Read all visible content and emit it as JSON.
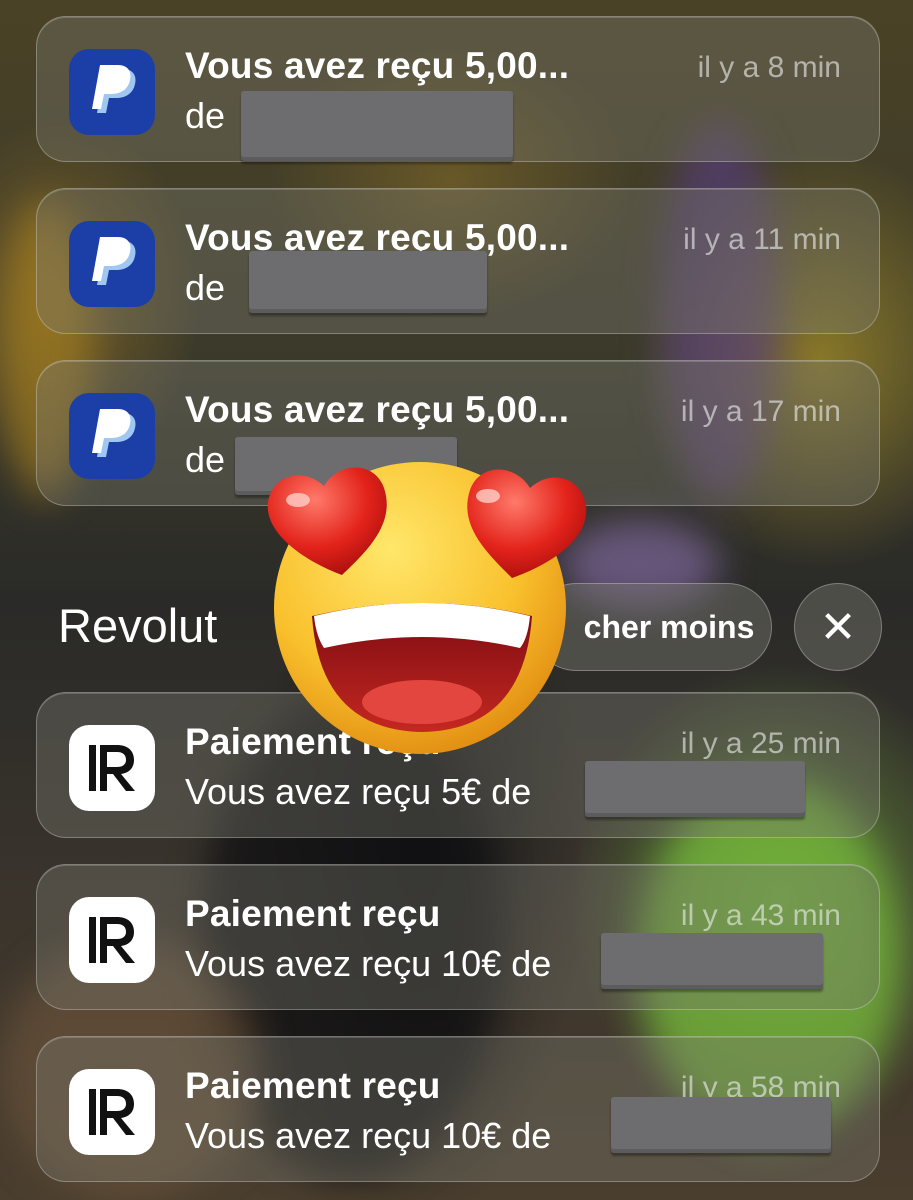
{
  "paypal_notifications": [
    {
      "title": "Vous avez reçu 5,00...",
      "time": "il y a 8 min",
      "body": "de"
    },
    {
      "title": "Vous avez reçu 5,00...",
      "time": "il y a 11 min",
      "body": "de"
    },
    {
      "title": "Vous avez reçu 5,00...",
      "time": "il y a 17 min",
      "body": "de"
    }
  ],
  "group": {
    "title": "Revolut",
    "show_less_label": "cher moins",
    "close_label": "✕"
  },
  "revolut_notifications": [
    {
      "title": "Paiement reçu",
      "time": "il y a 25 min",
      "body": "Vous avez reçu 5€ de"
    },
    {
      "title": "Paiement reçu",
      "time": "il y a 43 min",
      "body": "Vous avez reçu 10€ de"
    },
    {
      "title": "Paiement reçu",
      "time": "il y a 58 min",
      "body": "Vous avez reçu 10€ de"
    }
  ],
  "icons": {
    "paypal": "paypal-icon",
    "revolut": "revolut-icon",
    "close": "close-icon",
    "sticker": "heart-eyes-emoji-sticker"
  },
  "colors": {
    "paypal_blue": "#1b3fa7",
    "redaction_gray": "#6d6d6f"
  }
}
